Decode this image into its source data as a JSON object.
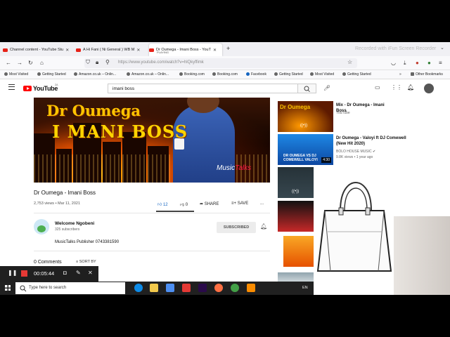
{
  "browser": {
    "tabs": [
      {
        "title": "Channel content - YouTube Stu"
      },
      {
        "title": "A Hi Fani ( Ni General ) WB M"
      },
      {
        "title": "Dr Oumega - Imani Boss - YouT",
        "sub": "PLAYING"
      }
    ],
    "url": "https://www.youtube.com/watch?v=hlQkyffimk",
    "watermark": "Recorded with iFun Screen Recorder",
    "bookmarks": [
      "Most Visited",
      "Getting Started",
      "Amazon.co.uk – Onlin...",
      "Amazon.co.uk – Onlin...",
      "Booking.com",
      "Booking.com",
      "Facebook",
      "Getting Started",
      "Most Visited",
      "Getting Started"
    ],
    "other_bookmarks": "Other Bookmarks"
  },
  "youtube": {
    "logo_text": "YouTube",
    "country": "ZA",
    "search_value": "imani boss"
  },
  "artwork": {
    "title": "Dr Oumega",
    "subtitle": "I MANI BOSS",
    "brand_a": "Music",
    "brand_b": "Talks"
  },
  "video": {
    "title": "Dr Oumega - Imani Boss",
    "info": "2,753 views • Mar 11, 2021",
    "likes": "12",
    "dislikes": "0",
    "share": "SHARE",
    "save": "SAVE",
    "more": "...",
    "channel": "Welcome Ngobeni",
    "subscribers": "325 subscribers",
    "subscribe": "SUBSCRIBED",
    "description": "MusicTalks Publisher 0743381590",
    "comments": "0 Comments",
    "sort": "SORT BY"
  },
  "sidebar": [
    {
      "title": "Mix - Dr Oumega - Imani Boss",
      "meta1": "YouTube",
      "meta2": "",
      "duration": "",
      "thumb": "Dr Oumega"
    },
    {
      "title": "Dr Oumega - Valoyi ft DJ Comewell (New Hit 2020)",
      "meta1": "BOLO HOUSE MUSIC ✔",
      "meta2": "9.8K views • 1 year ago",
      "duration": "4:30",
      "thumb": "DR OUMEGA VS DJ COMEWELL VALOYI"
    }
  ],
  "recorder": {
    "time": "00:05:44"
  },
  "taskbar": {
    "search_placeholder": "Type here to search",
    "lang": "EN"
  },
  "colors": {
    "youtube_red": "#ff0000",
    "like_blue": "#1565c0",
    "record_red": "#e53935"
  }
}
